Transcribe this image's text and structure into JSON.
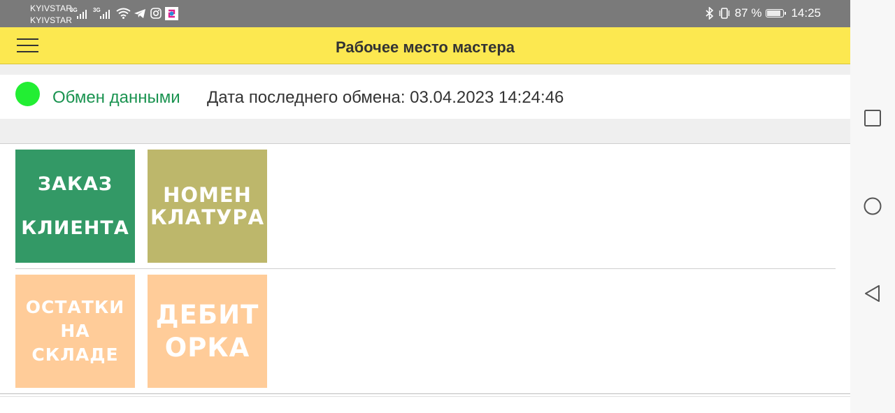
{
  "status_bar": {
    "carrier_1": "KYIVSTAR",
    "carrier_2": "KYIVSTAR",
    "network_1": "3G",
    "network_2": "3G",
    "battery_percent_text": "87 %",
    "battery_level": 0.87,
    "time": "14:25",
    "icons": [
      "wifi-icon",
      "telegram-icon",
      "instagram-icon",
      "app-icon",
      "bluetooth-icon",
      "vibrate-icon",
      "battery-icon"
    ]
  },
  "app_bar": {
    "title": "Рабочее место мастера",
    "menu_icon": "hamburger-menu-icon",
    "background": "#fce850"
  },
  "sync": {
    "indicator_color": "#22ee33",
    "link_label": "Обмен данными",
    "last_exchange": "Дата последнего обмена: 03.04.2023 14:24:46"
  },
  "tiles": [
    {
      "lines": [
        "ЗАКАЗ",
        "КЛИЕНТА"
      ],
      "color": "#339966"
    },
    {
      "lines": [
        "НОМЕН",
        "КЛАТУРА"
      ],
      "color": "#bdb76b"
    },
    {
      "lines": [
        "ОСТАТКИ",
        "НА",
        "СКЛАДЕ"
      ],
      "color": "#ffcc99"
    },
    {
      "lines": [
        "ДЕБИТ",
        "ОРКА"
      ],
      "color": "#ffcc99"
    }
  ],
  "nav_bar": {
    "buttons": [
      "recent-apps-icon",
      "home-icon",
      "back-icon"
    ]
  }
}
